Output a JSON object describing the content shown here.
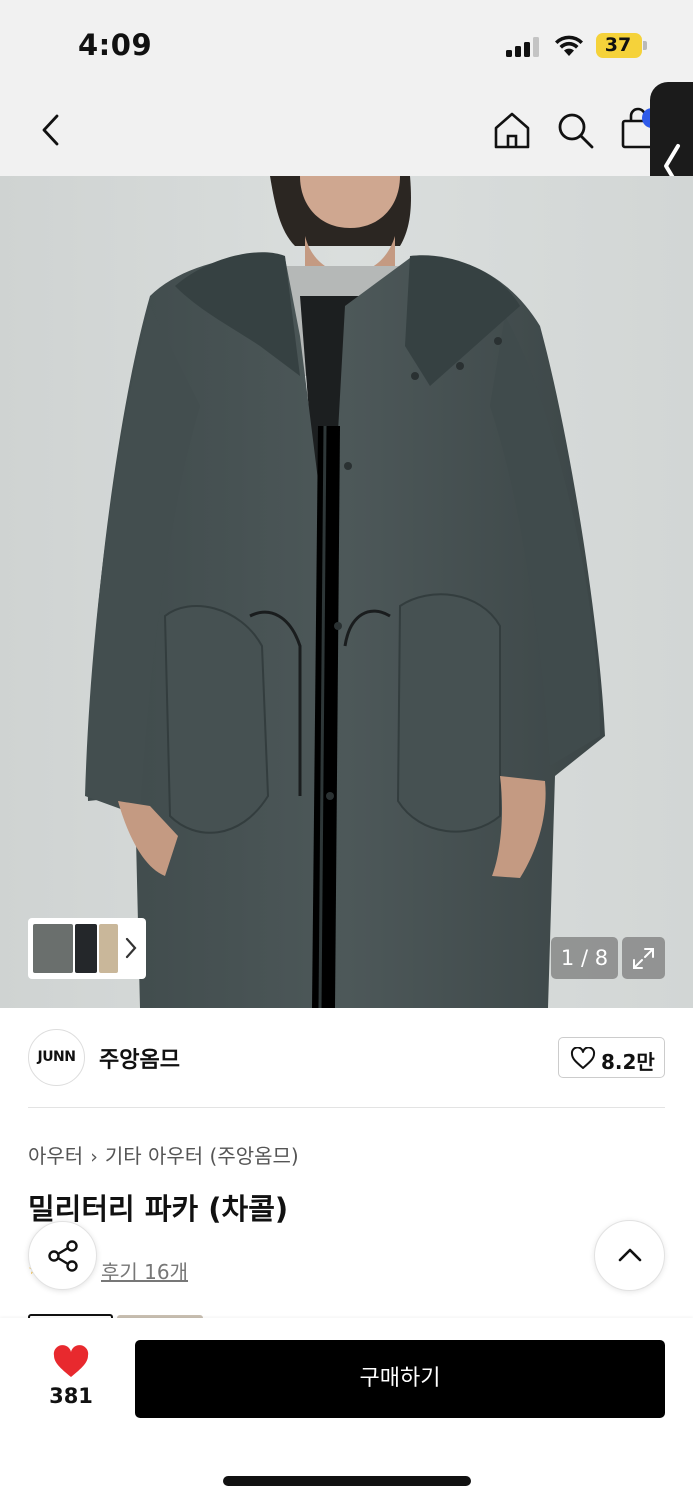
{
  "status_bar": {
    "time": "4:09",
    "battery_level": "37",
    "battery_color": "#f5d23a",
    "signal_icon": "cellular-signal-icon",
    "wifi_icon": "wifi-icon"
  },
  "nav": {
    "back_icon": "chevron-left-icon",
    "home_icon": "home-icon",
    "search_icon": "search-icon",
    "cart_icon": "shopping-bag-icon",
    "side_handle_icon": "chevron-left-icon"
  },
  "gallery": {
    "page_counter": "1 / 8",
    "thumb_arrow_icon": "chevron-right-icon",
    "expand_icon": "expand-icon"
  },
  "brand": {
    "logo_text": "JUNN",
    "name": "주앙옴므",
    "like_count": "8.2만",
    "like_icon": "heart-outline-icon"
  },
  "product": {
    "breadcrumb": [
      "아우터",
      "기타 아우터 (주앙옴므)"
    ],
    "title": "밀리터리 파카 (차콜)",
    "review_link": "후기 16개"
  },
  "actions": {
    "share_icon": "share-icon",
    "scroll_top_icon": "chevron-up-icon"
  },
  "bottom_bar": {
    "wish_icon": "heart-filled-icon",
    "wish_color": "#e8292e",
    "wish_count": "381",
    "buy_label": "구매하기"
  }
}
